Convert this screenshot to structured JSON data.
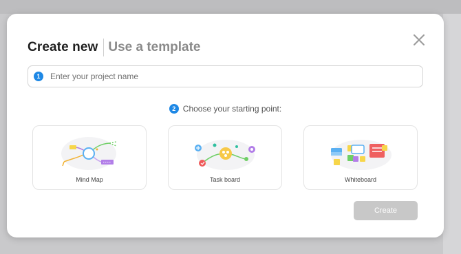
{
  "header": {
    "tab_create_new": "Create new",
    "tab_use_template": "Use a template"
  },
  "step1": {
    "badge": "1",
    "placeholder": "Enter your project name"
  },
  "step2": {
    "badge": "2",
    "label": "Choose your starting point:"
  },
  "cards": [
    {
      "label": "Mind Map",
      "icon": "mind-map-icon"
    },
    {
      "label": "Task board",
      "icon": "task-board-icon"
    },
    {
      "label": "Whiteboard",
      "icon": "whiteboard-icon"
    }
  ],
  "actions": {
    "create_label": "Create",
    "create_color": "#c8c8c8"
  },
  "colors": {
    "accent": "#1e88e5"
  }
}
